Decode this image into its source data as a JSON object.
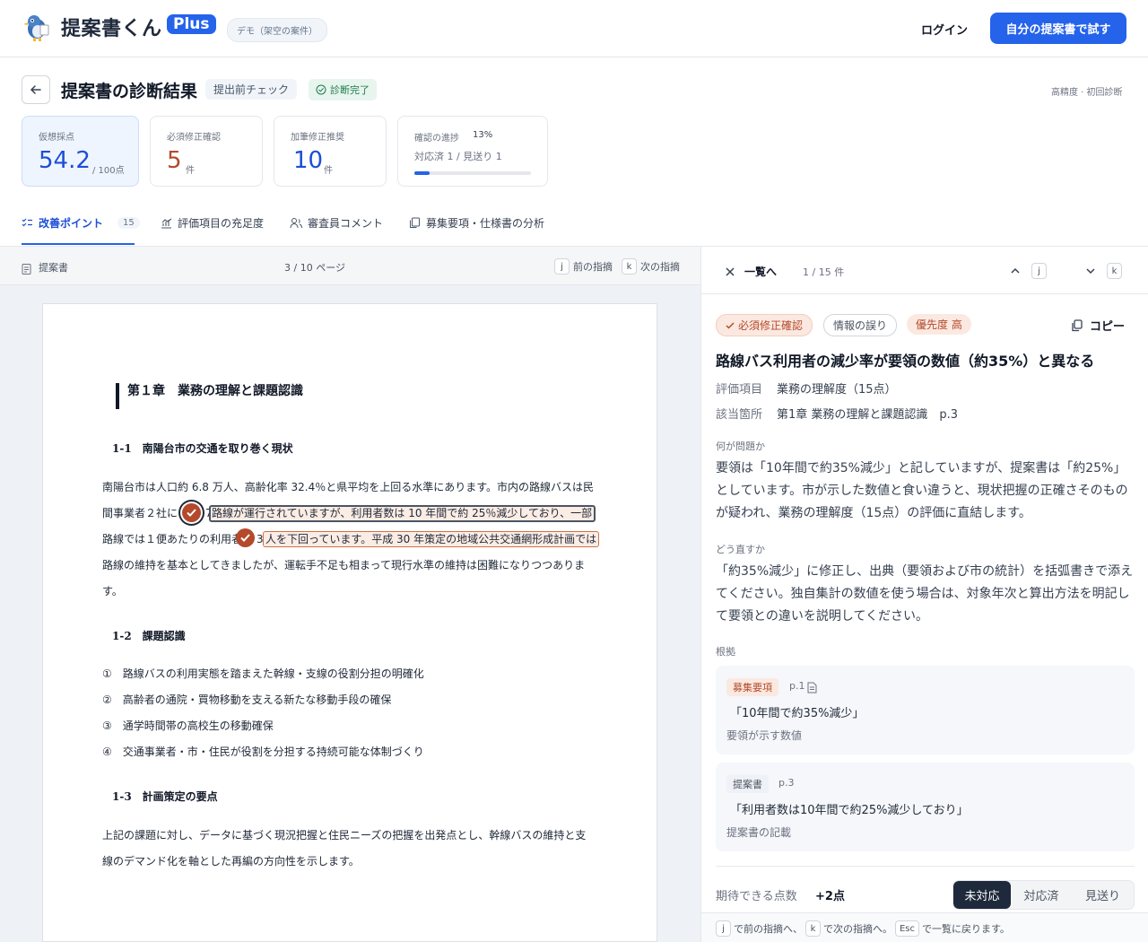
{
  "header": {
    "brand_name": "提案書くん",
    "brand_badge": "Plus",
    "demo_label": "デモ（架空の案件）",
    "login_label": "ログイン",
    "cta_label": "自分の提案書で試す"
  },
  "page": {
    "title": "提案書の診断結果",
    "tag_check": "提出前チェック",
    "tag_done": "診断完了",
    "meta": "高精度 · 初回診断"
  },
  "stats": {
    "score_label": "仮想採点",
    "score_value": "54.2",
    "score_unit": "/ 100点",
    "required_label": "必須修正確認",
    "required_value": "5",
    "required_unit": "件",
    "recommended_label": "加筆修正推奨",
    "recommended_value": "10",
    "recommended_unit": "件",
    "progress_label": "確認の進捗",
    "progress_pct": "13%",
    "progress_fraction": 0.13,
    "progress_detail": "対応済 1 / 見送り 1"
  },
  "tabs": [
    {
      "label": "改善ポイント",
      "count": "15"
    },
    {
      "label": "評価項目の充足度"
    },
    {
      "label": "審査員コメント"
    },
    {
      "label": "募集要項・仕様書の分析"
    }
  ],
  "viewer": {
    "doc_label": "提案書",
    "page_indicator": "3 / 10 ページ",
    "prev_key": "j",
    "prev_label": "前の指摘",
    "next_key": "k",
    "next_label": "次の指摘"
  },
  "doc": {
    "chapter": "第１章　業務の理解と課題認識",
    "s1_heading": "1-1　南陽台市の交通を取り巻く現状",
    "p1_l1": "南陽台市は人口約 6.8 万人、高齢化率 32.4％と県平均を上回る水準にあります。市内の路線バスは民",
    "p1_l2a": "間事業者２社に",
    "p1_l2b": "路線が運行されていますが、利用者数は 10 年間で約 25％減少しており、一部",
    "p1_l3a": "路線では１便あたりの利用者",
    "p1_l3b": "人を下回っています。平成 30 年策定の地域公共交通網形成計画では",
    "p1_l4": "路線の維持を基本としてきましたが、運転手不足も相まって現行水準の維持は困難になりつつありま",
    "p1_l5": "す。",
    "s2_heading": "1-2　課題認識",
    "items": [
      "①　路線バスの利用実態を踏まえた幹線・支線の役割分担の明確化",
      "②　高齢者の通院・買物移動を支える新たな移動手段の確保",
      "③　通学時間帯の高校生の移動確保",
      "④　交通事業者・市・住民が役割を分担する持続可能な体制づくり"
    ],
    "s3_heading": "1-3　計画策定の要点",
    "p3_l1": "上記の課題に対し、データに基づく現況把握と住民ニーズの把握を出発点とし、幹線バスの維持と支",
    "p3_l2": "線のデマンド化を軸とした再編の方向性を示します。"
  },
  "detail": {
    "back_label": "一覧へ",
    "counter": "1 / 15 件",
    "up_key": "j",
    "down_key": "k",
    "chip_required": "必須修正確認",
    "chip_type": "情報の誤り",
    "chip_priority": "優先度 高",
    "copy_label": "コピー",
    "title": "路線バス利用者の減少率が要領の数値（約35%）と異なる",
    "criterion_key": "評価項目",
    "criterion_val": "業務の理解度（15点）",
    "location_key": "該当箇所",
    "location_val": "第1章 業務の理解と課題認識　p.3",
    "problem_label": "何が問題か",
    "problem_text": "要領は「10年間で約35%減少」と記していますが、提案書は「約25%」としています。市が示した数値と食い違うと、現状把握の正確さそのものが疑われ、業務の理解度（15点）の評価に直結します。",
    "fix_label": "どう直すか",
    "fix_text": "「約35%減少」に修正し、出典（要領および市の統計）を括弧書きで添えてください。独自集計の数値を使う場合は、対象年次と算出方法を明記して要領との違いを説明してください。",
    "basis_label": "根拠",
    "ev1_tag": "募集要項",
    "ev1_page": "p.1",
    "ev1_quote": "「10年間で約35%減少」",
    "ev1_note": "要領が示す数値",
    "ev2_tag": "提案書",
    "ev2_page": "p.3",
    "ev2_quote": "「利用者数は10年間で約25%減少しており」",
    "ev2_note": "提案書の記載",
    "gain_label": "期待できる点数",
    "gain_value": "+2点",
    "status_open": "未対応",
    "status_done": "対応済",
    "status_skip": "見送り",
    "hint_j": "j",
    "hint_1": "で前の指摘へ、",
    "hint_k": "k",
    "hint_2": "で次の指摘へ。",
    "hint_esc": "Esc",
    "hint_3": "で一覧に戻ります。"
  },
  "colors": {
    "accent": "#2563eb",
    "required": "#b4492b",
    "done": "#1f7a4d"
  }
}
